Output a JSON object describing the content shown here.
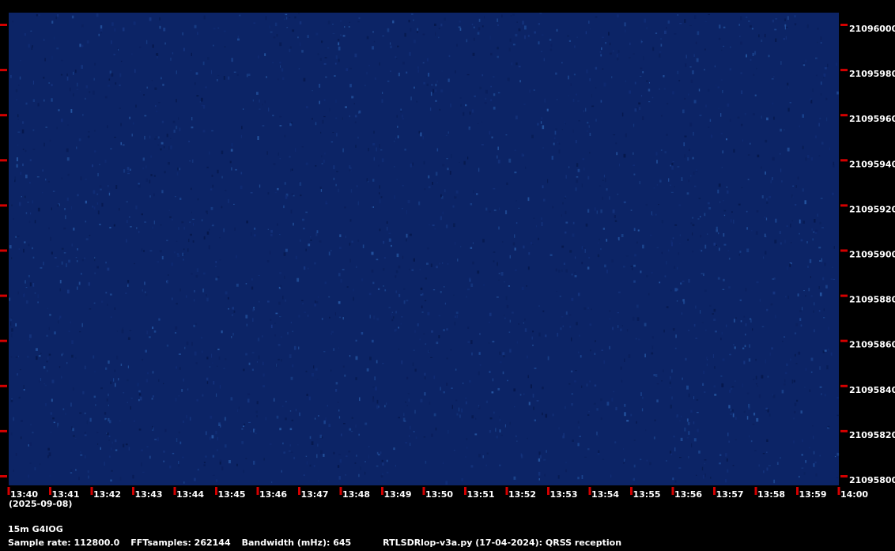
{
  "chart_data": {
    "type": "heatmap",
    "title": "",
    "xlabel": "",
    "ylabel": "",
    "x_ticks": [
      "13:40",
      "13:41",
      "13:42",
      "13:43",
      "13:44",
      "13:45",
      "13:46",
      "13:47",
      "13:48",
      "13:49",
      "13:50",
      "13:51",
      "13:52",
      "13:53",
      "13:54",
      "13:55",
      "13:56",
      "13:57",
      "13:58",
      "13:59",
      "14:00"
    ],
    "x_sublabel": "(2025-09-08)",
    "y_ticks": [
      "21096000",
      "21095980",
      "21095960",
      "21095940",
      "21095920",
      "21095900",
      "21095880",
      "21095860",
      "21095840",
      "21095820",
      "21095800"
    ],
    "ylim": [
      21095800,
      21096000
    ],
    "colors": {
      "background": "#000000",
      "waterfall_base": "#0c2466",
      "tick": "#d40000",
      "text": "#ffffff"
    }
  },
  "footer": {
    "station": "15m G4IOG",
    "sample_rate": "Sample rate: 112800.0",
    "fft_samples": "FFTsamples: 262144",
    "bandwidth": "Bandwidth (mHz): 645",
    "software": "RTLSDRlop-v3a.py (17-04-2024): QRSS reception"
  }
}
